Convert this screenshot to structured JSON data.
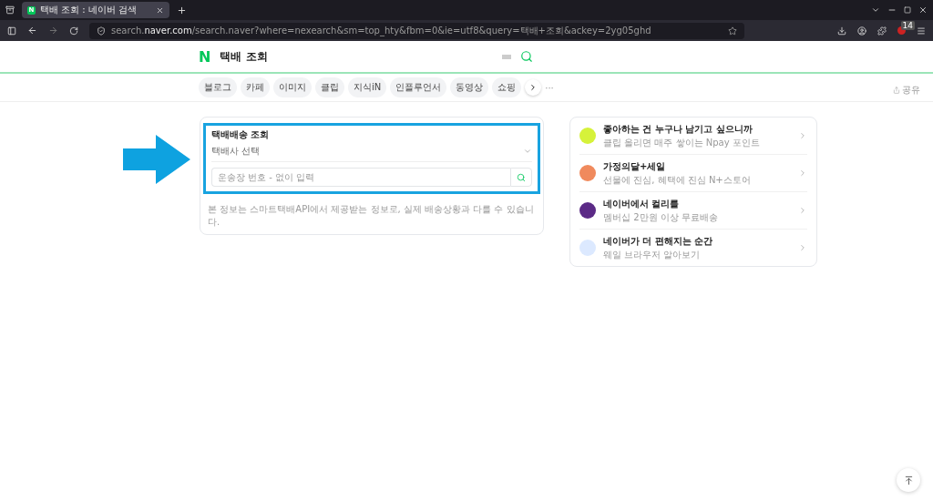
{
  "browser": {
    "tab": {
      "icon": "N",
      "title": "택배 조회 : 네이버 검색",
      "selected": true
    },
    "url_prefix": "search.",
    "url_domain": "naver.com",
    "url_rest": "/search.naver?where=nexearch&sm=top_hty&fbm=0&ie=utf8&query=택배+조회&ackey=2yg05ghd",
    "badge": "14"
  },
  "header": {
    "logo": "N",
    "query": "택배 조회"
  },
  "categories": [
    {
      "label": "블로그",
      "selected": false
    },
    {
      "label": "카페",
      "selected": false
    },
    {
      "label": "이미지",
      "selected": false
    },
    {
      "label": "클립",
      "selected": false
    },
    {
      "label": "지식iN",
      "selected": false
    },
    {
      "label": "인플루언서",
      "selected": false
    },
    {
      "label": "동영상",
      "selected": false
    },
    {
      "label": "쇼핑",
      "selected": false
    }
  ],
  "more": "···",
  "share": "공유",
  "tracker": {
    "title": "택배배송 조회",
    "carrier_placeholder": "택배사 선택",
    "number_placeholder": "운송장 번호 - 없이 입력",
    "notice": "본 정보는 스마트택배API에서 제공받는 정보로, 실제 배송상황과 다를 수 있습니다."
  },
  "promos": [
    {
      "title": "좋아하는 건 누구나 남기고 싶으니까",
      "subtitle": "클립 올리면 매주 쌓이는 Npay 포인트",
      "color": "#d6f23a"
    },
    {
      "title": "가정의달+세일",
      "subtitle": "선물에 진심, 혜택에 진심 N+스토어",
      "color": "#f08a5d"
    },
    {
      "title": "네이버에서 컬리를",
      "subtitle": "멤버십 2만원 이상 무료배송",
      "color": "#5b2a86"
    },
    {
      "title": "네이버가 더 편해지는 순간",
      "subtitle": "웨일 브라우저 알아보기",
      "color": "#dce9ff"
    }
  ]
}
